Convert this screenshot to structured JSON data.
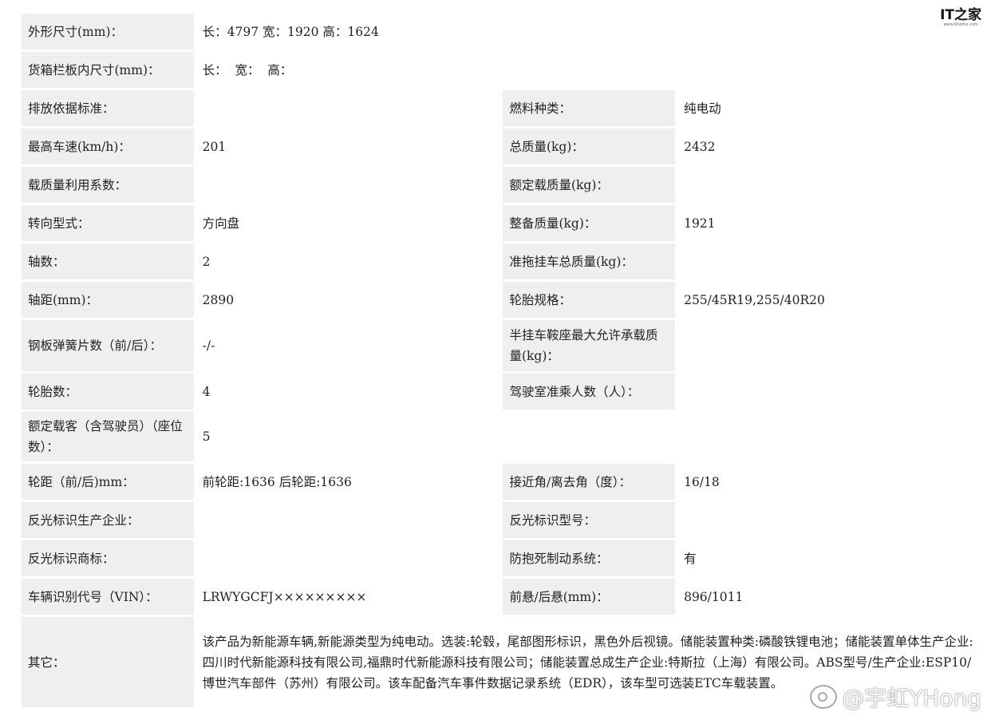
{
  "rows": {
    "r1": {
      "label": "外形尺寸(mm)：",
      "value": "长：4797 宽：1920 高：1624"
    },
    "r2": {
      "label": "货箱栏板内尺寸(mm)：",
      "value": "长：  宽：  高："
    },
    "r3": {
      "l1": "排放依据标准：",
      "v1": "",
      "l2": "燃料种类：",
      "v2": "纯电动"
    },
    "r4": {
      "l1": "最高车速(km/h)：",
      "v1": "201",
      "l2": "总质量(kg)：",
      "v2": "2432"
    },
    "r5": {
      "l1": "载质量利用系数：",
      "v1": "",
      "l2": "额定载质量(kg)：",
      "v2": ""
    },
    "r6": {
      "l1": "转向型式：",
      "v1": "方向盘",
      "l2": "整备质量(kg)：",
      "v2": "1921"
    },
    "r7": {
      "l1": "轴数：",
      "v1": "2",
      "l2": "准拖挂车总质量(kg)：",
      "v2": ""
    },
    "r8": {
      "l1": "轴距(mm)：",
      "v1": "2890",
      "l2": "轮胎规格：",
      "v2": "255/45R19,255/40R20"
    },
    "r9": {
      "l1": "钢板弹簧片数（前/后）：",
      "v1": "-/-",
      "l2": "半挂车鞍座最大允许承载质量(kg)：",
      "v2": ""
    },
    "r10": {
      "l1": "轮胎数：",
      "v1": "4",
      "l2": "驾驶室准乘人数（人）：",
      "v2": ""
    },
    "r11": {
      "label": "额定载客（含驾驶员）（座位数）：",
      "value": "5"
    },
    "r12": {
      "l1": "轮距（前/后)mm：",
      "v1": "前轮距:1636 后轮距:1636",
      "l2": "接近角/离去角（度）：",
      "v2": "16/18"
    },
    "r13": {
      "l1": "反光标识生产企业：",
      "v1": "",
      "l2": "反光标识型号：",
      "v2": ""
    },
    "r14": {
      "l1": "反光标识商标：",
      "v1": "",
      "l2": "防抱死制动系统：",
      "v2": "有"
    },
    "r15": {
      "l1": "车辆识别代号（VIN）：",
      "v1": "LRWYGCFJ×××××××××",
      "l2": "前悬/后悬(mm)：",
      "v2": "896/1011"
    },
    "r16": {
      "label": "其它：",
      "value": "该产品为新能源车辆,新能源类型为纯电动。选装:轮毂，尾部图形标识，黑色外后视镜。储能装置种类:磷酸铁锂电池；储能装置单体生产企业:四川时代新能源科技有限公司,福鼎时代新能源科技有限公司；储能装置总成生产企业:特斯拉（上海）有限公司。ABS型号/生产企业:ESP10/博世汽车部件（苏州）有限公司。该车配备汽车事件数据记录系统（EDR），该车型可选装ETC车载装置。"
    }
  },
  "logo": {
    "mark": "IT之家",
    "url": "www.ithome.com"
  },
  "watermark": {
    "text": "@宇虹YHong"
  }
}
